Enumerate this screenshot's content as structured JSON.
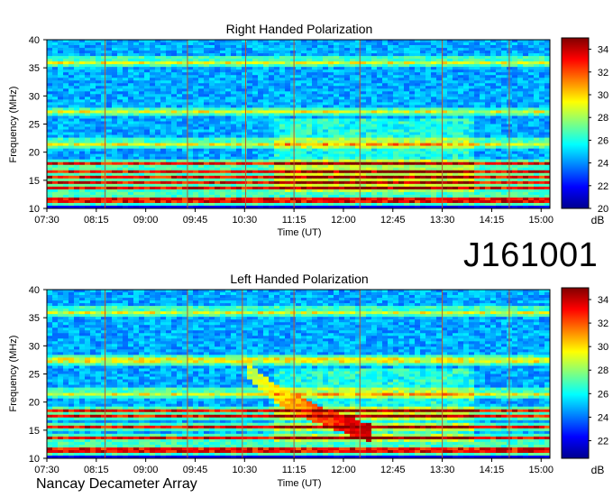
{
  "observation_id": "J161001",
  "credit": "Nancay Decameter Array",
  "chart_data": [
    {
      "type": "heatmap",
      "title": "Right Handed Polarization",
      "xlabel": "Time (UT)",
      "ylabel": "Frequency (MHz)",
      "x_ticks": [
        "07:30",
        "08:15",
        "09:00",
        "09:45",
        "10:30",
        "11:15",
        "12:00",
        "12:45",
        "13:30",
        "14:15",
        "15:00"
      ],
      "y_ticks": [
        10,
        15,
        20,
        25,
        30,
        35,
        40
      ],
      "ylim": [
        10,
        40
      ],
      "colorbar": {
        "label": "dB",
        "range": [
          20,
          35
        ],
        "ticks": [
          20,
          22,
          24,
          26,
          28,
          30,
          32,
          34
        ]
      },
      "features": {
        "interference_bands_mhz": [
          11.5,
          13.5,
          14.5,
          15.5,
          16.5,
          18.0,
          21.5,
          27.2,
          36.0
        ],
        "vertical_markers_ut": [
          "08:23",
          "09:38",
          "10:31",
          "11:15",
          "12:15",
          "13:30",
          "14:31"
        ]
      }
    },
    {
      "type": "heatmap",
      "title": "Left Handed Polarization",
      "xlabel": "Time (UT)",
      "ylabel": "Frequency (MHz)",
      "x_ticks": [
        "07:30",
        "08:15",
        "09:00",
        "09:45",
        "10:30",
        "11:15",
        "12:00",
        "12:45",
        "13:30",
        "14:15",
        "15:00"
      ],
      "y_ticks": [
        10,
        15,
        20,
        25,
        30,
        35,
        40
      ],
      "ylim": [
        10,
        40
      ],
      "colorbar": {
        "label": "dB",
        "range": [
          20.5,
          35
        ],
        "ticks": [
          22,
          24,
          26,
          28,
          30,
          32,
          34
        ]
      },
      "features": {
        "interference_bands_mhz": [
          11.5,
          13.5,
          15.5,
          17.5,
          18.5,
          21.5,
          27.5,
          36.0
        ],
        "emission_arc": {
          "start_ut": "10:30",
          "end_ut": "12:25",
          "start_mhz": 28.5,
          "end_mhz": 14.5
        },
        "vertical_markers_ut": [
          "08:23",
          "09:38",
          "10:28",
          "11:15",
          "12:15",
          "13:30",
          "14:31"
        ]
      }
    }
  ],
  "colors": {
    "scale": [
      "#00008f",
      "#0000ff",
      "#0080ff",
      "#00ffff",
      "#80ff80",
      "#ffff00",
      "#ff8000",
      "#ff0000",
      "#800000"
    ],
    "marker": "#b85a30"
  }
}
